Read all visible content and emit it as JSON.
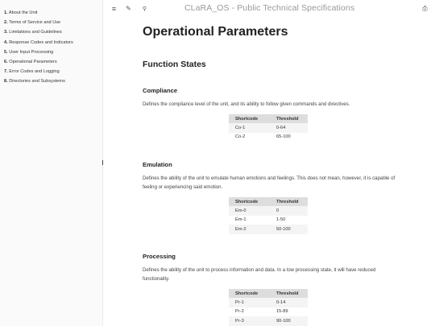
{
  "app": {
    "title": "CLaRA_OS - Public Technical Specifications"
  },
  "toolbar": {
    "menu_icon": "≡",
    "edit_icon": "✎",
    "search_icon": "⚲",
    "print_icon": "⎙"
  },
  "sidebar": {
    "items": [
      {
        "num": "1.",
        "label": "About the Unit"
      },
      {
        "num": "2.",
        "label": "Terms of Service and Use"
      },
      {
        "num": "3.",
        "label": "Limitations and Guidelines"
      },
      {
        "num": "4.",
        "label": "Response Codes and Indicators"
      },
      {
        "num": "5.",
        "label": "User Input Processing"
      },
      {
        "num": "6.",
        "label": "Operational Parameters"
      },
      {
        "num": "7.",
        "label": "Error Codes and Logging"
      },
      {
        "num": "8.",
        "label": "Directories and Subsystems"
      }
    ]
  },
  "main": {
    "heading": "Operational Parameters",
    "subheading": "Function States",
    "table_headers": {
      "code": "Shortcode",
      "threshold": "Threshold"
    },
    "sections": [
      {
        "title": "Compliance",
        "description": "Defines the compliance level of the unit, and its ability to follow given commands and directives.",
        "rows": [
          {
            "code": "Co-1",
            "threshold": "0-64"
          },
          {
            "code": "Co-2",
            "threshold": "65-100"
          }
        ]
      },
      {
        "title": "Emulation",
        "description": "Defines the ability of the unit to emulate human emotions and feelings. This does not mean, however, it is capable of feeling or experiencing said emotion.",
        "rows": [
          {
            "code": "Em-0",
            "threshold": "0"
          },
          {
            "code": "Em-1",
            "threshold": "1-50"
          },
          {
            "code": "Em-2",
            "threshold": "50-100"
          }
        ]
      },
      {
        "title": "Processing",
        "description": "Defines the ability of the unit to process information and data. In a low processing state, it will have reduced functionality.",
        "rows": [
          {
            "code": "Pr-1",
            "threshold": "0-14"
          },
          {
            "code": "Pr-2",
            "threshold": "15-89"
          },
          {
            "code": "Pr-3",
            "threshold": "90-100"
          }
        ]
      }
    ]
  }
}
